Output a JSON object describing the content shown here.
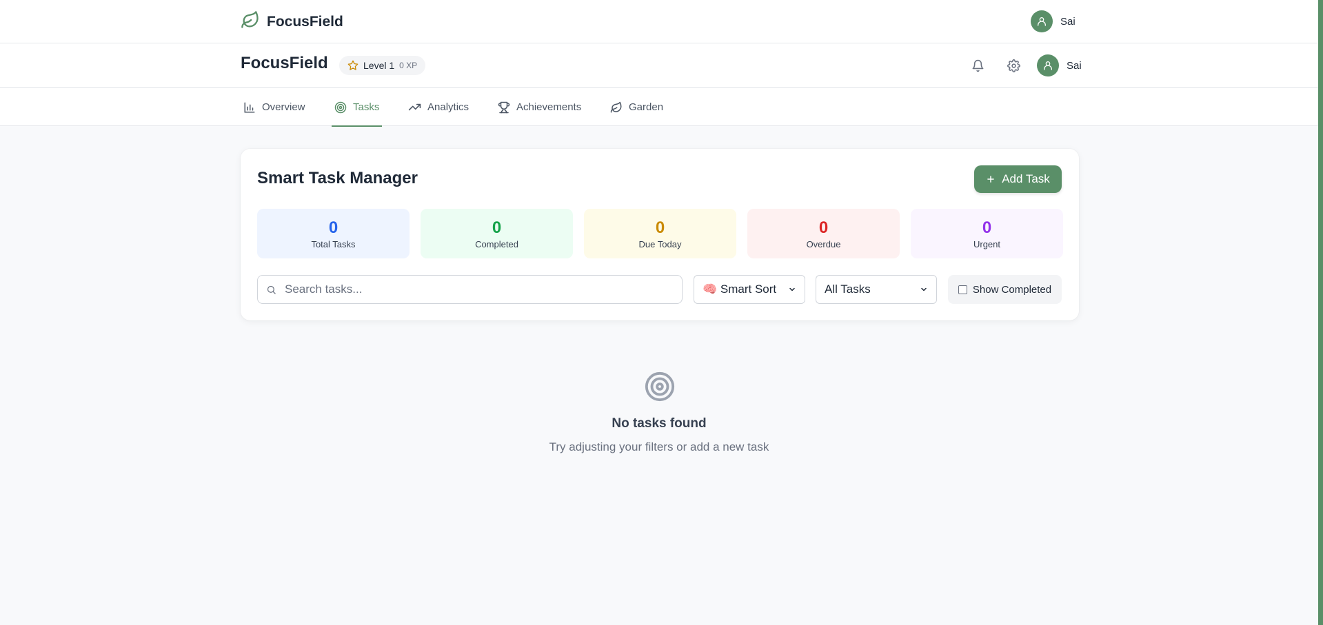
{
  "top_header": {
    "brand": "FocusField",
    "user_name": "Sai"
  },
  "app_header": {
    "title": "FocusField",
    "level": "Level 1",
    "xp": "0 XP",
    "user_name": "Sai"
  },
  "nav": {
    "tabs": [
      {
        "label": "Overview",
        "icon": "bar-chart-icon"
      },
      {
        "label": "Tasks",
        "icon": "target-icon",
        "active": true
      },
      {
        "label": "Analytics",
        "icon": "trending-up-icon"
      },
      {
        "label": "Achievements",
        "icon": "trophy-icon"
      },
      {
        "label": "Garden",
        "icon": "leaf-icon"
      }
    ]
  },
  "task_manager": {
    "title": "Smart Task Manager",
    "add_button": "Add Task",
    "stats": [
      {
        "value": "0",
        "label": "Total Tasks",
        "color": "#2563eb"
      },
      {
        "value": "0",
        "label": "Completed",
        "color": "#16a34a"
      },
      {
        "value": "0",
        "label": "Due Today",
        "color": "#ca8a04"
      },
      {
        "value": "0",
        "label": "Overdue",
        "color": "#dc2626"
      },
      {
        "value": "0",
        "label": "Urgent",
        "color": "#9333ea"
      }
    ],
    "search_placeholder": "Search tasks...",
    "sort_value": "🧠 Smart Sort",
    "filter_value": "All Tasks",
    "show_completed_label": "Show Completed",
    "show_completed_checked": false
  },
  "empty_state": {
    "icon": "target-icon",
    "title": "No tasks found",
    "subtitle": "Try adjusting your filters or add a new task"
  },
  "colors": {
    "accent": "#5a8f68"
  }
}
